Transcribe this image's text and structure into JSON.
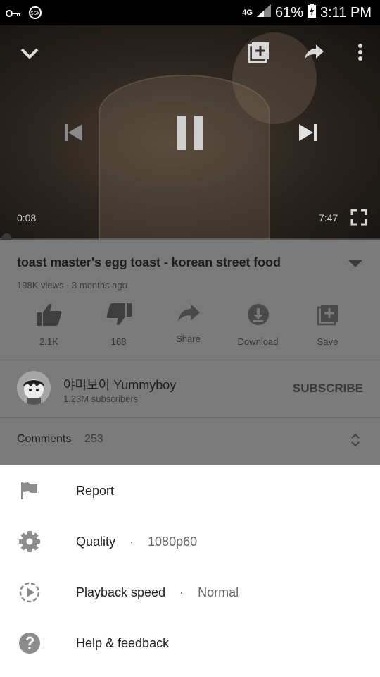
{
  "status_bar": {
    "network": "4G",
    "battery": "61%",
    "time": "3:11 PM"
  },
  "player": {
    "elapsed": "0:08",
    "duration": "7:47",
    "progress": 0.017
  },
  "video": {
    "title": "toast master's egg toast - korean street food",
    "meta": "198K views · 3 months ago"
  },
  "actions": [
    {
      "label": "2.1K",
      "icon": "thumbs-up-icon"
    },
    {
      "label": "168",
      "icon": "thumbs-down-icon"
    },
    {
      "label": "Share",
      "icon": "share-icon"
    },
    {
      "label": "Download",
      "icon": "download-icon"
    },
    {
      "label": "Save",
      "icon": "add-to-playlist-icon"
    }
  ],
  "channel": {
    "name": "야미보이 Yummyboy",
    "subscribers": "1.23M subscribers",
    "subscribe_label": "SUBSCRIBE"
  },
  "comments": {
    "label": "Comments",
    "count": "253"
  },
  "sheet": {
    "items": [
      {
        "label": "Report",
        "icon": "flag-icon",
        "value": ""
      },
      {
        "label": "Quality",
        "icon": "gear-icon",
        "value": "1080p60"
      },
      {
        "label": "Playback speed",
        "icon": "playback-speed-icon",
        "value": "Normal"
      },
      {
        "label": "Help & feedback",
        "icon": "help-icon",
        "value": ""
      }
    ],
    "separator": "·"
  }
}
